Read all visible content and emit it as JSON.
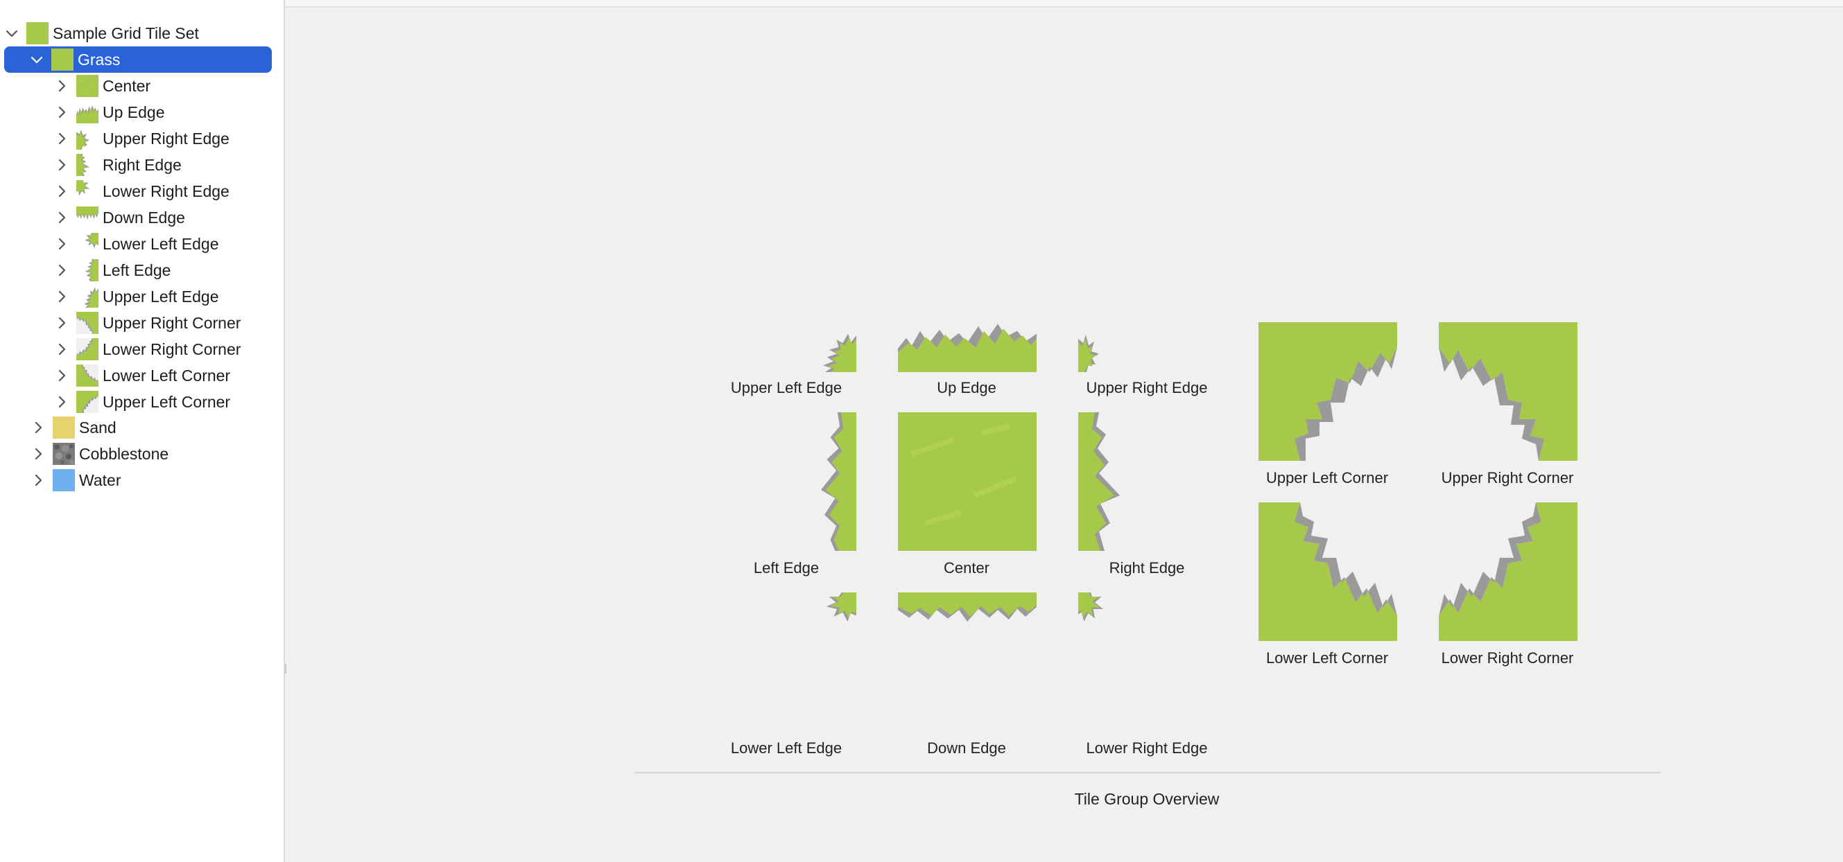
{
  "colors": {
    "grass": "#a6c94a",
    "sand": "#e8d26e",
    "cobblestone": "#7a7a7a",
    "water": "#6fb0ee",
    "selection": "#2a62d9",
    "shadow": "#9a9a9a"
  },
  "sidebar": {
    "root": {
      "label": "Sample Grid Tile Set",
      "expanded": true
    },
    "groups": [
      {
        "label": "Grass",
        "selected": true,
        "expanded": true,
        "children": [
          {
            "label": "Center",
            "icon": "center"
          },
          {
            "label": "Up Edge",
            "icon": "up-edge"
          },
          {
            "label": "Upper Right Edge",
            "icon": "upper-right-edge"
          },
          {
            "label": "Right Edge",
            "icon": "right-edge"
          },
          {
            "label": "Lower Right Edge",
            "icon": "lower-right-edge"
          },
          {
            "label": "Down Edge",
            "icon": "down-edge"
          },
          {
            "label": "Lower Left Edge",
            "icon": "lower-left-edge"
          },
          {
            "label": "Left Edge",
            "icon": "left-edge"
          },
          {
            "label": "Upper Left Edge",
            "icon": "upper-left-edge"
          },
          {
            "label": "Upper Right Corner",
            "icon": "upper-right-corner"
          },
          {
            "label": "Lower Right Corner",
            "icon": "lower-right-corner"
          },
          {
            "label": "Lower Left Corner",
            "icon": "lower-left-corner"
          },
          {
            "label": "Upper Left Corner",
            "icon": "upper-left-corner"
          }
        ]
      },
      {
        "label": "Sand",
        "selected": false,
        "expanded": false
      },
      {
        "label": "Cobblestone",
        "selected": false,
        "expanded": false
      },
      {
        "label": "Water",
        "selected": false,
        "expanded": false
      }
    ]
  },
  "overview": {
    "tiles": {
      "upper_left_edge": "Upper Left Edge",
      "up_edge": "Up Edge",
      "upper_right_edge": "Upper Right Edge",
      "left_edge": "Left Edge",
      "center": "Center",
      "right_edge": "Right Edge",
      "lower_left_edge": "Lower Left Edge",
      "down_edge": "Down Edge",
      "lower_right_edge": "Lower Right Edge",
      "upper_left_corner": "Upper Left Corner",
      "upper_right_corner": "Upper Right Corner",
      "lower_left_corner": "Lower Left Corner",
      "lower_right_corner": "Lower Right Corner"
    },
    "caption": "Tile Group Overview"
  }
}
